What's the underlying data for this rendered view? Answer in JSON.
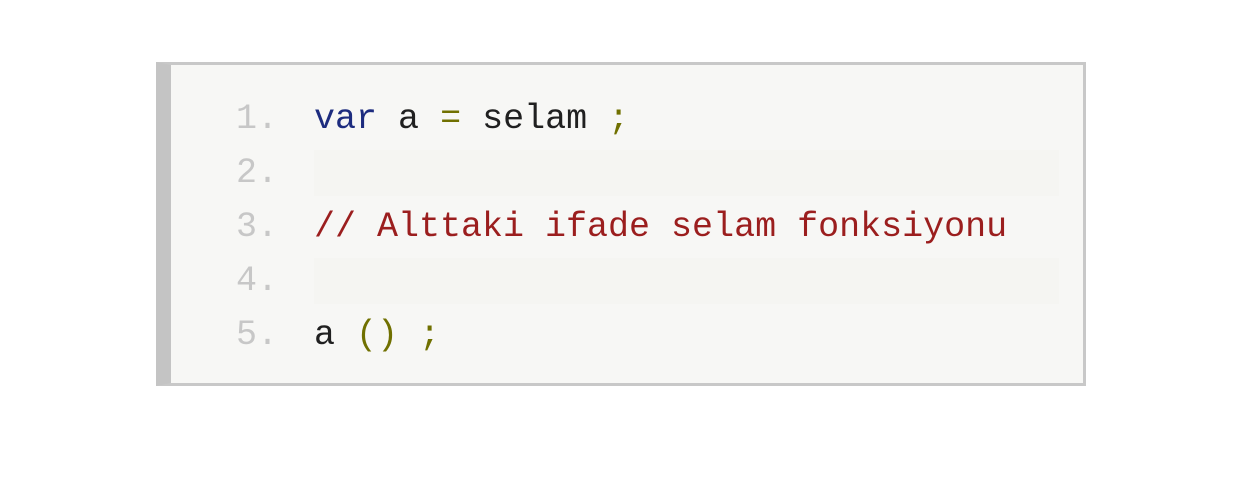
{
  "code_block": {
    "colors": {
      "background": "#f7f7f5",
      "line_number": "#c7c7c7",
      "plain_text": "#202020",
      "keyword": "#1d2c7f",
      "punctuation": "#707000",
      "comment": "#9b1e1e"
    },
    "lines": [
      {
        "number": "1.",
        "keyword": "var",
        "variable": "a",
        "operator": "=",
        "value": "selam",
        "semicolon": ";"
      },
      {
        "number": "2.",
        "text": ""
      },
      {
        "number": "3.",
        "comment": "// Alttaki ifade selam fonksiyonu"
      },
      {
        "number": "4.",
        "text": ""
      },
      {
        "number": "5.",
        "function_name": "a",
        "call_parens": "()",
        "semicolon": ";"
      }
    ]
  }
}
